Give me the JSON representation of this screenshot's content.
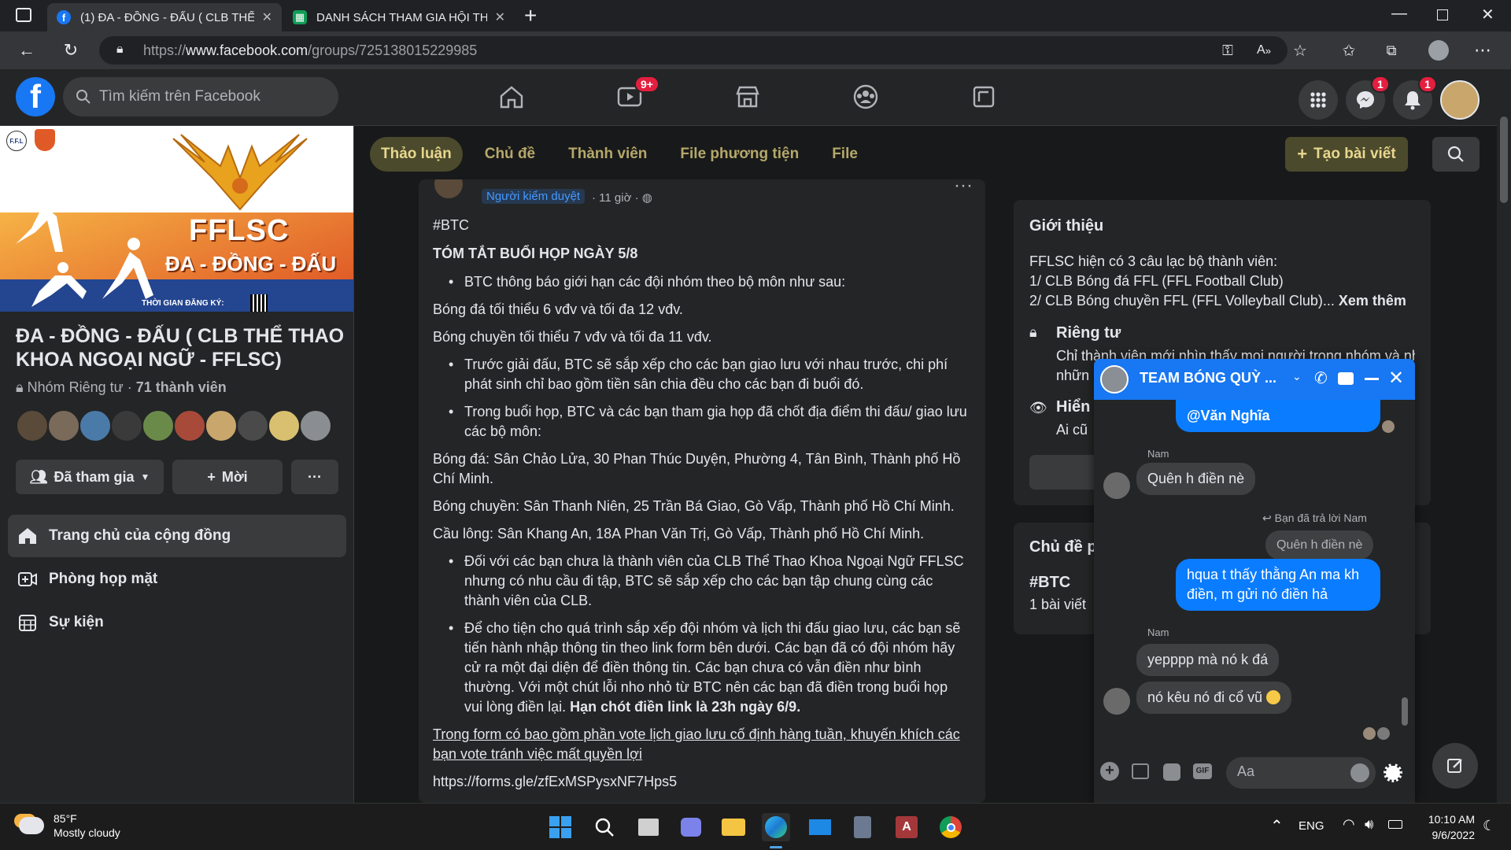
{
  "browser": {
    "tabs": [
      {
        "label": "(1) ĐA - ĐỒNG - ĐẤU ( CLB THỂ",
        "icon": "facebook-icon",
        "active": true
      },
      {
        "label": "DANH SÁCH THAM GIA HỘI THẢ",
        "icon": "sheets-icon",
        "active": false
      }
    ],
    "url_prefix": "https://",
    "url_domain": "www.facebook.com",
    "url_path": "/groups/725138015229985"
  },
  "fb": {
    "search_placeholder": "Tìm kiếm trên Facebook",
    "watch_badge": "9+",
    "messenger_badge": "1",
    "notif_badge": "1"
  },
  "group": {
    "name": "ĐA - ĐỒNG - ĐẤU ( CLB THỂ THAO KHOA NGOẠI NGỮ - FFLSC)",
    "privacy": "Nhóm Riêng tư",
    "members": "71 thành viên",
    "cover": {
      "brand": "FFLSC",
      "slogan": "ĐA - ĐỒNG - ĐẤU",
      "time": "THỜI GIAN ĐĂNG KÝ:",
      "small_logo": "F.F.L"
    },
    "joined_label": "Đã tham gia",
    "invite_label": "Mời",
    "more_label": "···",
    "menu": [
      {
        "label": "Trang chủ của cộng đồng",
        "icon": "home-icon",
        "active": true
      },
      {
        "label": "Phòng họp mặt",
        "icon": "video-plus-icon",
        "active": false
      },
      {
        "label": "Sự kiện",
        "icon": "calendar-icon",
        "active": false
      }
    ]
  },
  "tabs": [
    "Thảo luận",
    "Chủ đề",
    "Thành viên",
    "File phương tiện",
    "File"
  ],
  "create_label": "Tạo bài viết",
  "post": {
    "role": "Người kiểm duyệt",
    "time": "· 11 giờ ·",
    "hashtag": "#BTC",
    "title": "TÓM TẮT BUỔI HỌP NGÀY 5/8",
    "b1": "BTC thông báo giới hạn các đội nhóm theo bộ môn như sau:",
    "p1": "Bóng đá tối thiểu 6 vđv và tối đa 12 vđv.",
    "p2": "Bóng chuyền tối thiểu 7 vđv và tối đa 11 vđv.",
    "b2": "Trước giải đấu, BTC sẽ sắp xếp cho các bạn giao lưu với nhau trước, chi phí phát sinh chỉ bao gồm tiền sân chia đều cho các bạn đi buổi đó.",
    "b3": "Trong buổi họp, BTC và các bạn tham gia họp đã chốt địa điểm thi đấu/ giao lưu các bộ môn:",
    "p3": "Bóng đá: Sân Chảo Lửa, 30 Phan Thúc Duyện, Phường 4, Tân Bình, Thành phố Hồ Chí Minh.",
    "p4": "Bóng chuyền: Sân Thanh Niên, 25 Trần Bá Giao, Gò Vấp, Thành phố Hồ Chí Minh.",
    "p5": "Cầu lông: Sân Khang An, 18A Phan Văn Trị, Gò Vấp, Thành phố Hồ Chí Minh.",
    "b4": "Đối với các bạn chưa là thành viên của CLB Thể Thao Khoa Ngoại Ngữ FFLSC nhưng có nhu cầu đi tập, BTC sẽ sắp xếp cho các bạn tập chung cùng các thành viên của CLB.",
    "b5": "Để cho tiện cho quá trình sắp xếp đội nhóm và lịch thi đấu giao lưu, các bạn sẽ tiến hành nhập thông tin theo link form bên dưới. Các bạn đã có đội nhóm hãy cử ra một đại diện để điền thông tin. Các bạn chưa có vẫn điền như bình thường. Với một chút lỗi nho nhỏ từ BTC nên các bạn đã điền trong buổi họp vui lòng điền lại.",
    "b5_bold": "Hạn chót điền link là 23h ngày 6/9.",
    "underline": "Trong form có bao gồm phần vote lịch giao lưu cố định hàng tuần, khuyến khích các bạn vote tránh việc mất quyền lợi",
    "link": "https://forms.gle/zfExMSPysxNF7Hps5"
  },
  "about": {
    "title": "Giới thiệu",
    "l1": "FFLSC hiện có 3 câu lạc bộ thành viên:",
    "l2": "1/ CLB Bóng đá FFL (FFL Football Club)",
    "l3": "2/ CLB Bóng chuyền FFL (FFL Volleyball Club)...",
    "see_more": "Xem thêm",
    "private_title": "Riêng tư",
    "private_desc": "Chỉ thành viên mới nhìn thấy mọi người trong nhóm và những",
    "private_desc2": "nhữn",
    "visible_title": "Hiển",
    "visible_desc": "Ai cũ"
  },
  "topics": {
    "title": "Chủ đề p",
    "tag": "#BTC",
    "count": "1 bài viết"
  },
  "chat": {
    "title": "TEAM BÓNG QUỲ ...",
    "m0": "@Văn Nghĩa",
    "name1": "Nam",
    "m1": "Quên h điền nè",
    "reply_note": "Bạn đã trả lời Nam",
    "quoted": "Quên h điền nè",
    "m2": "hqua t thấy thằng An ma kh điền, m gửi nó điền hả",
    "name2": "Nam",
    "m3": "yepppp mà nó k đá",
    "m4": "nó kêu nó đi cổ vũ",
    "input_placeholder": "Aa"
  },
  "taskbar": {
    "temp": "85°F",
    "weather": "Mostly cloudy",
    "lang": "ENG",
    "time": "10:10 AM",
    "date": "9/6/2022"
  }
}
